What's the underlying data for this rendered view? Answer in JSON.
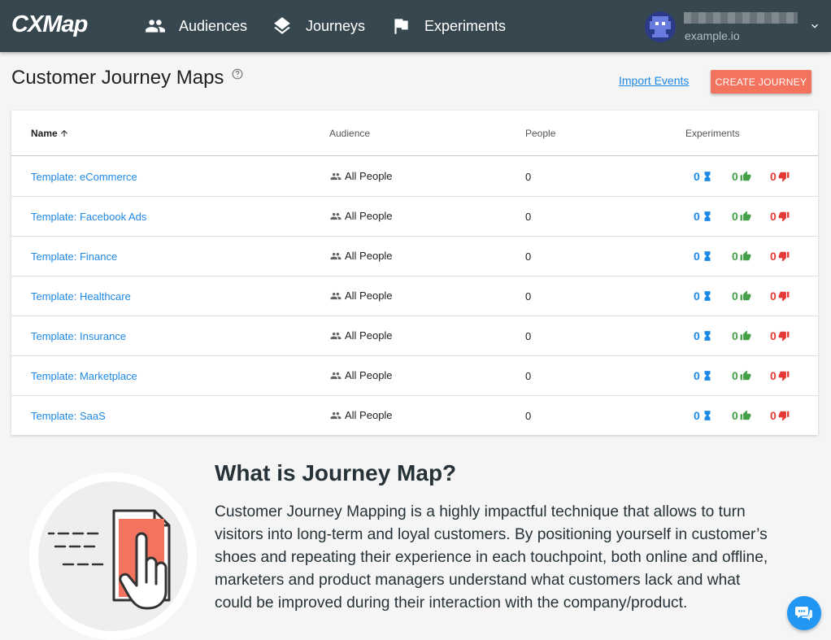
{
  "brand": {
    "logo_text": "CXMap"
  },
  "nav": {
    "items": [
      {
        "label": "Audiences",
        "icon": "people-icon"
      },
      {
        "label": "Journeys",
        "icon": "layers-icon"
      },
      {
        "label": "Experiments",
        "icon": "flag-icon"
      }
    ]
  },
  "user": {
    "domain": "example.io"
  },
  "page": {
    "title": "Customer Journey Maps",
    "import_link": "Import Events",
    "create_button": "CREATE JOURNEY"
  },
  "table": {
    "columns": {
      "name": "Name",
      "audience": "Audience",
      "people": "People",
      "experiments": "Experiments"
    },
    "rows": [
      {
        "name": "Template: eCommerce",
        "audience": "All People",
        "people": "0",
        "running": "0",
        "won": "0",
        "lost": "0"
      },
      {
        "name": "Template: Facebook Ads",
        "audience": "All People",
        "people": "0",
        "running": "0",
        "won": "0",
        "lost": "0"
      },
      {
        "name": "Template: Finance",
        "audience": "All People",
        "people": "0",
        "running": "0",
        "won": "0",
        "lost": "0"
      },
      {
        "name": "Template: Healthcare",
        "audience": "All People",
        "people": "0",
        "running": "0",
        "won": "0",
        "lost": "0"
      },
      {
        "name": "Template: Insurance",
        "audience": "All People",
        "people": "0",
        "running": "0",
        "won": "0",
        "lost": "0"
      },
      {
        "name": "Template: Marketplace",
        "audience": "All People",
        "people": "0",
        "running": "0",
        "won": "0",
        "lost": "0"
      },
      {
        "name": "Template: SaaS",
        "audience": "All People",
        "people": "0",
        "running": "0",
        "won": "0",
        "lost": "0"
      }
    ]
  },
  "info": {
    "title": "What is Journey Map?",
    "body": "Customer Journey Mapping is a highly impactful technique that allows to turn visitors into long-term and loyal customers. By positioning yourself in customer’s shoes and repeating their experience in each touchpoint, both online and offline, marketers and product managers understand what customers lack and what could be improved during their interaction with the company/product."
  },
  "colors": {
    "topbar": "#37474f",
    "accent": "#f4735e",
    "link": "#1e88e5",
    "running": "#1e88e5",
    "won": "#43a047",
    "lost": "#e53935"
  }
}
